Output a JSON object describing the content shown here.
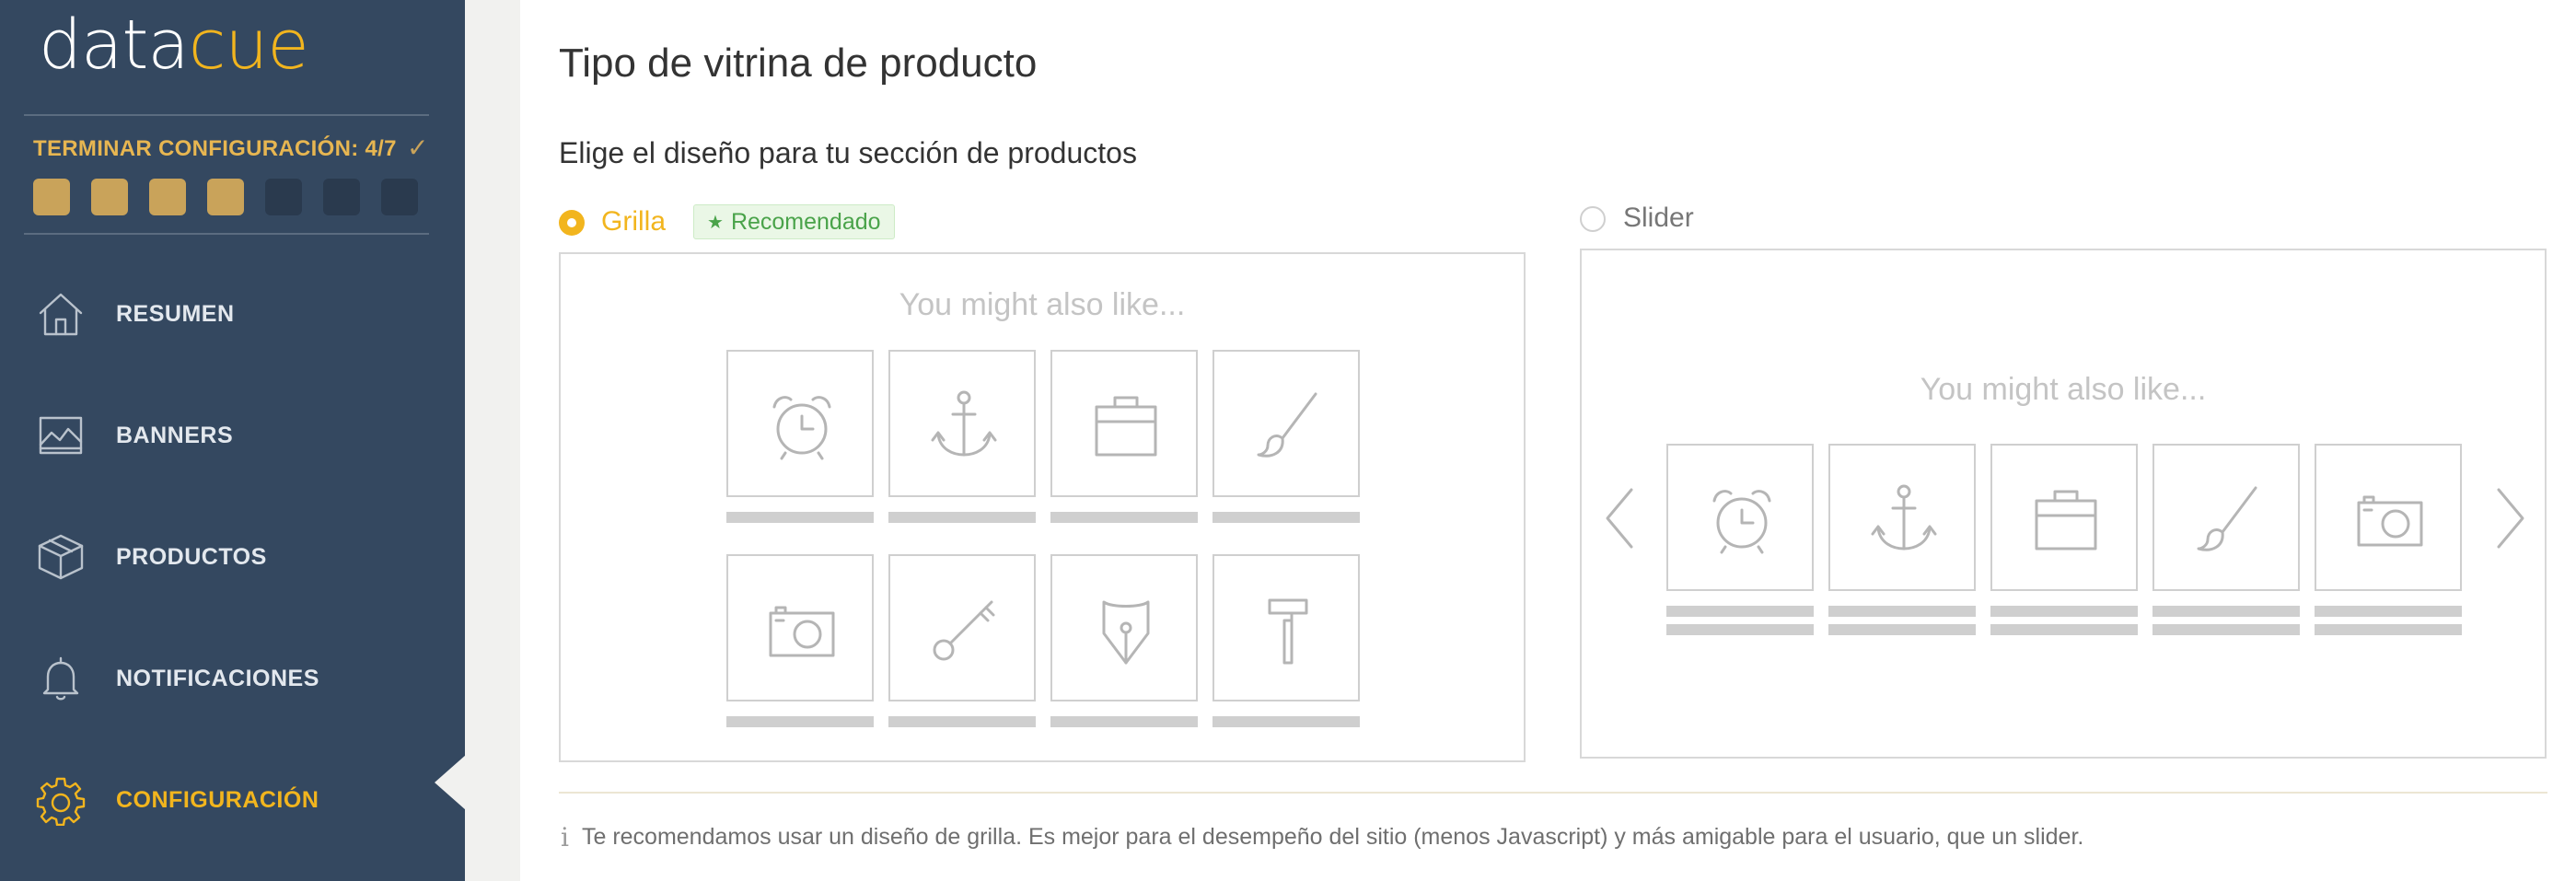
{
  "brand": {
    "part1": "data",
    "part2": "cue",
    "accent_color": "#f2b51e"
  },
  "setup": {
    "label": "TERMINAR CONFIGURACIÓN: 4/7",
    "check_icon": "check-icon",
    "steps_total": 7,
    "steps_done": 4
  },
  "nav": {
    "items": [
      {
        "label": "RESUMEN",
        "icon": "home-icon"
      },
      {
        "label": "BANNERS",
        "icon": "image-icon"
      },
      {
        "label": "PRODUCTOS",
        "icon": "box-icon"
      },
      {
        "label": "NOTIFICACIONES",
        "icon": "bell-icon"
      },
      {
        "label": "CONFIGURACIÓN",
        "icon": "gear-icon",
        "active": true
      }
    ]
  },
  "main": {
    "title": "Tipo de vitrina de producto",
    "subtitle": "Elige el diseño para tu sección de productos",
    "options": {
      "grid": {
        "label": "Grilla",
        "selected": true,
        "badge": "Recomendado",
        "badge_icon": "star-icon"
      },
      "slider": {
        "label": "Slider",
        "selected": false
      }
    },
    "preview_title": "You might also like...",
    "grid_icons": [
      "alarm-clock-icon",
      "anchor-icon",
      "briefcase-icon",
      "brush-icon",
      "camera-icon",
      "key-icon",
      "pen-nib-icon",
      "hammer-icon"
    ],
    "slider_icons": [
      "alarm-clock-icon",
      "anchor-icon",
      "briefcase-icon",
      "brush-icon",
      "camera-icon"
    ],
    "info_icon": "info-icon",
    "info": "Te recomendamos usar un diseño de grilla. Es mejor para el desempeño del sitio (menos Javascript) y más amigable para el usuario, que un slider."
  }
}
